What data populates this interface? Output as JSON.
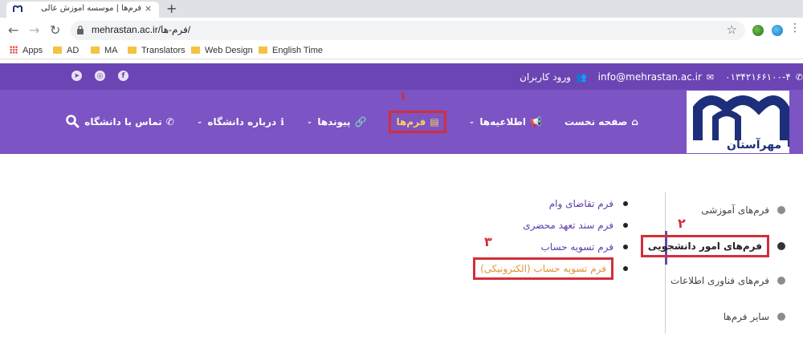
{
  "browser": {
    "tab_title": "فرم‌ها | موسسه آموزش عالی مهرآستان",
    "tab_close": "×",
    "new_tab": "+",
    "url": "mehrastan.ac.ir/فرم-ها/",
    "back": "←",
    "forward": "→",
    "reload": "↻",
    "star": "☆",
    "bookmarks": [
      {
        "label": "Apps",
        "type": "apps"
      },
      {
        "label": "AD",
        "type": "folder"
      },
      {
        "label": "MA",
        "type": "folder"
      },
      {
        "label": "Translators",
        "type": "folder"
      },
      {
        "label": "Web Design",
        "type": "folder"
      },
      {
        "label": "English Time",
        "type": "folder"
      }
    ]
  },
  "topbar": {
    "phone": "۰۱۳۴۲۱۶۶۱۰۰-۴",
    "email": "info@mehrastan.ac.ir",
    "login": "ورود کاربران",
    "social": [
      "telegram-icon",
      "instagram-icon",
      "facebook-icon"
    ]
  },
  "nav": {
    "logo_text": "مهرآستان",
    "items": [
      {
        "label": "صفحه نخست",
        "icon": "home-icon",
        "dropdown": false
      },
      {
        "label": "اطلاعیه‌ها",
        "icon": "megaphone-icon",
        "dropdown": true
      },
      {
        "label": "فرم‌ها",
        "icon": "document-icon",
        "dropdown": false
      },
      {
        "label": "پیوندها",
        "icon": "link-icon",
        "dropdown": true
      },
      {
        "label": "درباره دانشگاه",
        "icon": "info-icon",
        "dropdown": true
      },
      {
        "label": "تماس با دانشگاه",
        "icon": "phone-icon",
        "dropdown": false
      }
    ],
    "step_1": "۱"
  },
  "sidebar": {
    "items": [
      {
        "label": "فرم‌های آموزشی"
      },
      {
        "label": "فرم‌های امور دانشجویی"
      },
      {
        "label": "فرم‌های فناوری اطلاعات"
      },
      {
        "label": "سایر فرم‌ها"
      }
    ],
    "active_index": 1,
    "step_2": "۲"
  },
  "forms": {
    "items": [
      {
        "label": "فرم تقاضای وام"
      },
      {
        "label": "فرم سند تعهد محضری"
      },
      {
        "label": "فرم تسویه حساب"
      },
      {
        "label": "فرم تسویه حساب (الکترونیکی)"
      }
    ],
    "highlighted_index": 3,
    "step_3": "۳"
  },
  "colors": {
    "topbar": "#6b45b3",
    "nav": "#7c54c4",
    "highlight_border": "#d22f3b",
    "active_link": "#ffd15c",
    "orange_link": "#e0973a"
  }
}
